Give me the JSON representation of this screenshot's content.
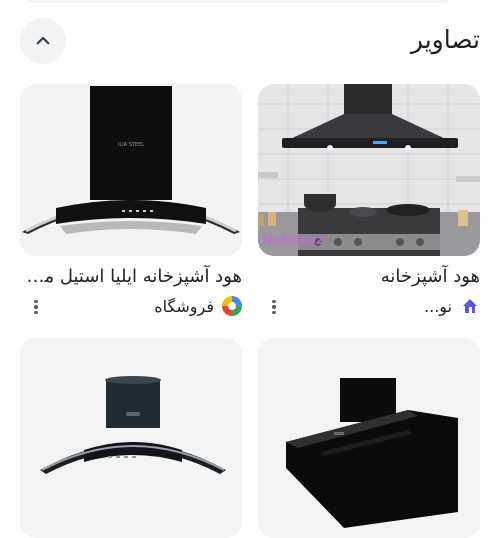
{
  "section": {
    "title": "تصاویر",
    "collapse_icon": "chevron-up-icon"
  },
  "results": [
    {
      "caption": "هود آشپزخانه",
      "source": "نو...",
      "favicon": "house-icon",
      "watermark": "Nobesaz",
      "accent": "#5b57e6"
    },
    {
      "caption": "هود آشپزخانه ایلیا استیل مد...",
      "source": "فروشگاه",
      "favicon": "multicolor-logo-icon",
      "brand_text": "ILIA STEEL",
      "colors": [
        "#4285f4",
        "#fbbc05",
        "#ea4335",
        "#34a853"
      ]
    },
    {
      "caption": "",
      "source": ""
    },
    {
      "caption": "",
      "source": ""
    }
  ]
}
